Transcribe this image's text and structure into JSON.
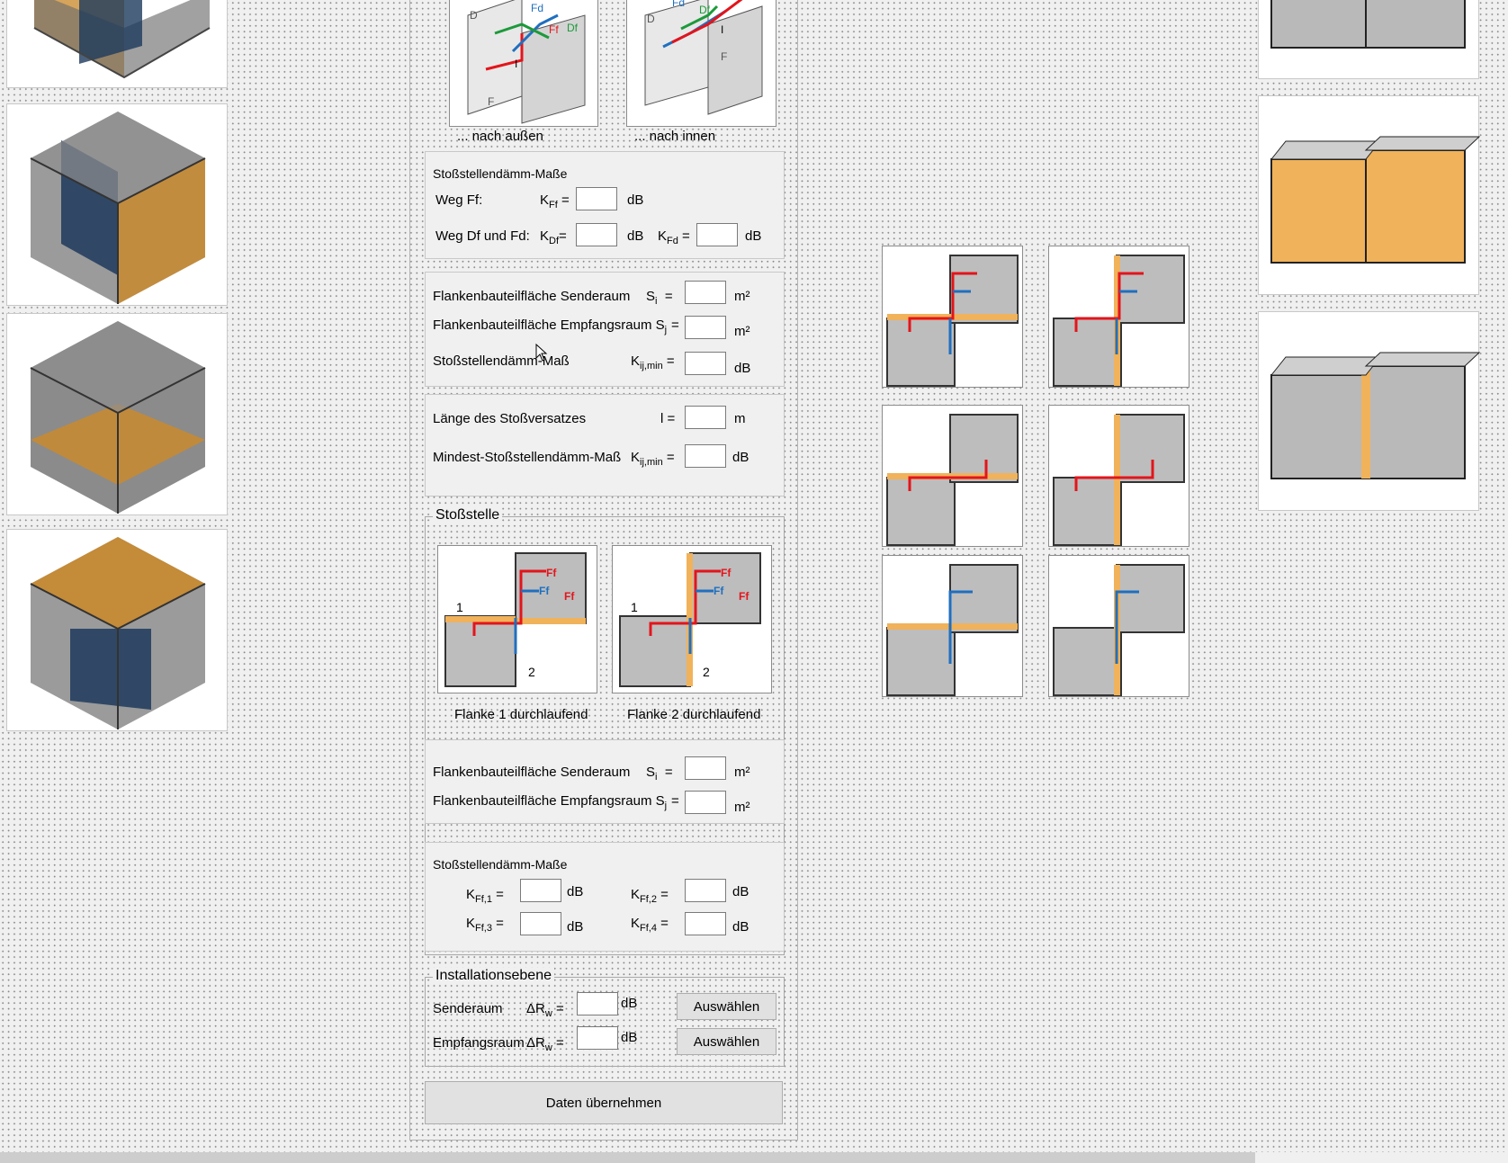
{
  "colors": {
    "orange": "#f0b25a",
    "blue": "#1f6fbf",
    "red": "#e4141b",
    "green": "#1c9a3a",
    "grey": "#8e8e8e"
  },
  "top_diagrams": {
    "outward_caption": "... nach außen",
    "inward_caption": "... nach innen"
  },
  "junction_section": {
    "heading": "Stoßstellendämm-Maße",
    "path_ff_label": "Weg Ff:",
    "k_ff_sym": "K",
    "k_ff_sub": "Ff",
    "eq": "=",
    "unit_db": "dB",
    "path_df_fd_label": "Weg Df und Fd:",
    "k_df_sym": "K",
    "k_df_sub": "Df",
    "k_fd_sym": "K",
    "k_fd_sub": "Fd"
  },
  "flank_section": {
    "sender_label": "Flankenbauteilfläche Senderaum",
    "si_sym": "S",
    "si_sub": "i",
    "receiver_label": "Flankenbauteilfläche Empfangsraum S",
    "sj_sub": "j",
    "unit_m2": "m²",
    "junction_label": "Stoßstellendämm-Maß",
    "kij_sym": "K",
    "kij_sub": "ij,min"
  },
  "offset_section": {
    "length_label": "Länge des Stoßversatzes",
    "l_sym": "l =",
    "unit_m": "m",
    "min_label": "Mindest-Stoßstellendämm-Maß"
  },
  "stossstelle": {
    "legend": "Stoßstelle",
    "flank1_caption": "Flanke 1  durchlaufend",
    "flank2_caption": "Flanke 2 durchlaufend",
    "num_1": "1",
    "num_2": "2",
    "sender_label": "Flankenbauteilfläche Senderaum",
    "receiver_label": "Flankenbauteilfläche Empfangsraum S",
    "masses_heading": "Stoßstellendämm-Maße",
    "kff1_sub": "Ff,1",
    "kff2_sub": "Ff,2",
    "kff3_sub": "Ff,3",
    "kff4_sub": "Ff,4"
  },
  "installation": {
    "legend": "Installationsebene",
    "sender_label": "Senderaum",
    "receiver_label": "Empfangsraum",
    "dr_sym": "ΔR",
    "dr_sub": "w",
    "select_label": "Auswählen"
  },
  "submit_label": "Daten übernehmen",
  "diagram_labels": {
    "ff1": "Ff",
    "ff2": "Ff",
    "ff3": "Ff",
    "ff4": "Ff",
    "fd": "Fd",
    "df": "Df",
    "d": "D",
    "f": "F",
    "i": "I"
  }
}
